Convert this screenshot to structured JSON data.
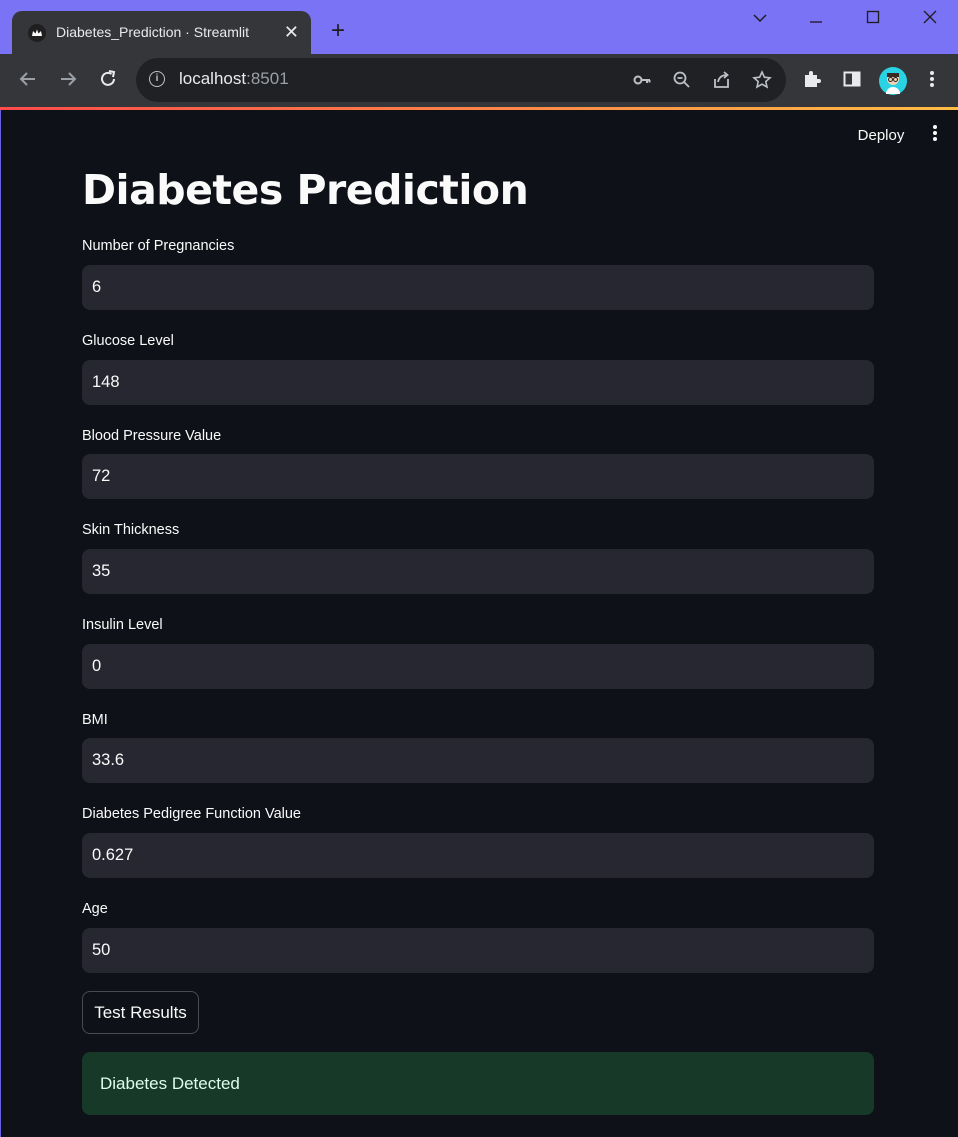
{
  "browser": {
    "tab_title": "Diabetes_Prediction · Streamlit",
    "url_host": "localhost",
    "url_port": ":8501"
  },
  "header": {
    "deploy_label": "Deploy"
  },
  "page": {
    "title": "Diabetes Prediction"
  },
  "fields": [
    {
      "label": "Number of Pregnancies",
      "value": "6"
    },
    {
      "label": "Glucose Level",
      "value": "148"
    },
    {
      "label": "Blood Pressure Value",
      "value": "72"
    },
    {
      "label": "Skin Thickness",
      "value": "35"
    },
    {
      "label": "Insulin Level",
      "value": "0"
    },
    {
      "label": "BMI",
      "value": "33.6"
    },
    {
      "label": "Diabetes Pedigree Function Value",
      "value": "0.627"
    },
    {
      "label": "Age",
      "value": "50"
    }
  ],
  "actions": {
    "test_button": "Test Results"
  },
  "result": {
    "message": "Diabetes Detected",
    "color": "#173928"
  },
  "colors": {
    "background": "#0e1117",
    "input_bg": "#262730",
    "browser_frame": "#7b73f5"
  }
}
